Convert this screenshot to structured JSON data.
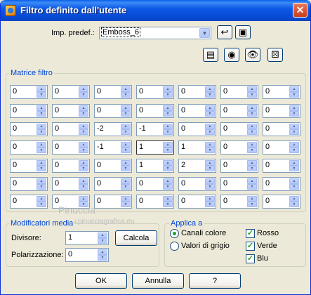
{
  "window": {
    "title": "Filtro definito dall'utente",
    "close_glyph": "✕"
  },
  "preset": {
    "label": "Imp. predef.:",
    "value": "Emboss_6"
  },
  "toolbar_top": [
    {
      "name": "reset-icon",
      "glyph": "↩"
    },
    {
      "name": "save-icon",
      "glyph": "▣"
    }
  ],
  "toolbar_icons": [
    {
      "name": "document-icon",
      "glyph": "▤"
    },
    {
      "name": "eye-lock-icon",
      "glyph": "◉"
    },
    {
      "name": "eye-icon",
      "glyph": "👁"
    },
    {
      "name": "dice-icon",
      "glyph": "⚄"
    }
  ],
  "matrix": {
    "title": "Matrice filtro",
    "rows": [
      [
        "0",
        "0",
        "0",
        "0",
        "0",
        "0",
        "0"
      ],
      [
        "0",
        "0",
        "0",
        "0",
        "0",
        "0",
        "0"
      ],
      [
        "0",
        "0",
        "-2",
        "-1",
        "0",
        "0",
        "0"
      ],
      [
        "0",
        "0",
        "-1",
        "1",
        "1",
        "0",
        "0"
      ],
      [
        "0",
        "0",
        "0",
        "1",
        "2",
        "0",
        "0"
      ],
      [
        "0",
        "0",
        "0",
        "0",
        "0",
        "0",
        "0"
      ],
      [
        "0",
        "0",
        "0",
        "0",
        "0",
        "0",
        "0"
      ]
    ]
  },
  "modifier": {
    "title": "Modificatori media",
    "divisor_label": "Divisore:",
    "divisor_value": "1",
    "calculate_label": "Calcola",
    "bias_label": "Polarizzazione:",
    "bias_value": "0"
  },
  "apply": {
    "title": "Applica a",
    "radios": [
      {
        "label": "Canali colore",
        "checked": true
      },
      {
        "label": "Valori di grigio",
        "checked": false
      }
    ],
    "checks": [
      {
        "label": "Rosso",
        "checked": true
      },
      {
        "label": "Verde",
        "checked": true
      },
      {
        "label": "Blu",
        "checked": true
      }
    ]
  },
  "buttons": {
    "ok": "OK",
    "cancel": "Annulla",
    "help": "?"
  },
  "watermark": {
    "line1": "Pinuccia",
    "line2": "www.pinucciagrafica.eu"
  },
  "colors": {
    "titlebar": "#0a5fe8",
    "accent_green": "#21a121",
    "group_title": "#0046d5"
  }
}
